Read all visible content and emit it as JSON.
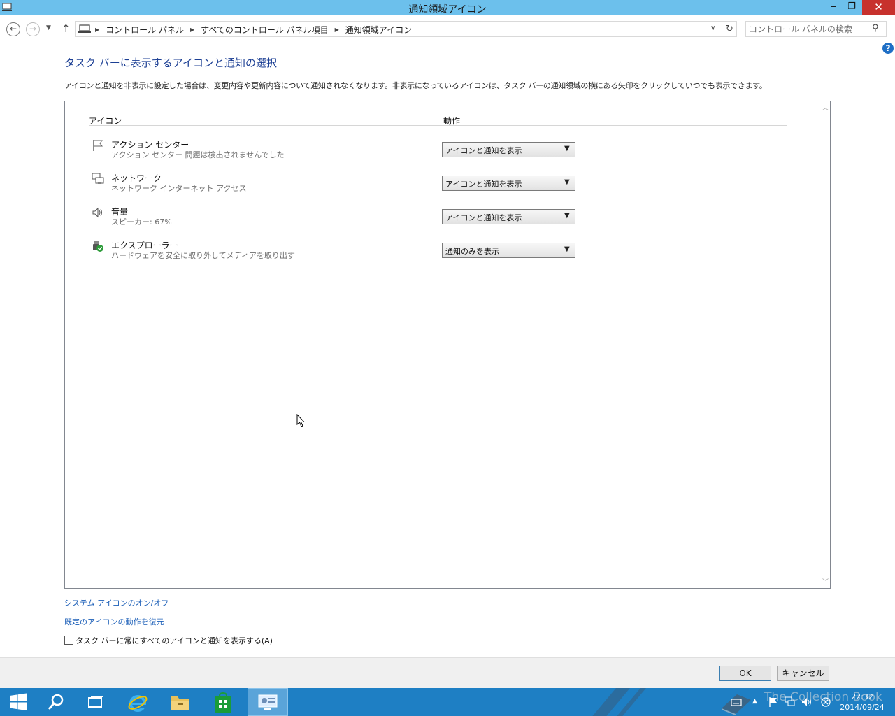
{
  "window": {
    "title": "通知領域アイコン",
    "min_glyph": "‒",
    "max_glyph": "❐",
    "close_glyph": "✕"
  },
  "address": {
    "crumbs": [
      "コントロール パネル",
      "すべてのコントロール パネル項目",
      "通知領域アイコン"
    ],
    "search_placeholder": "コントロール パネルの検索"
  },
  "help_glyph": "?",
  "content": {
    "heading": "タスク バーに表示するアイコンと通知の選択",
    "description": "アイコンと通知を非表示に設定した場合は、変更内容や更新内容について通知されなくなります。非表示になっているアイコンは、タスク バーの通知領域の横にある矢印をクリックしていつでも表示できます。",
    "col_icon": "アイコン",
    "col_action": "動作",
    "rows": [
      {
        "name": "アクション センター",
        "sub": "アクション センター  問題は検出されませんでした",
        "action": "アイコンと通知を表示",
        "icon": "flag-icon"
      },
      {
        "name": "ネットワーク",
        "sub": "ネットワーク インターネット アクセス",
        "action": "アイコンと通知を表示",
        "icon": "network-icon"
      },
      {
        "name": "音量",
        "sub": "スピーカー: 67%",
        "action": "アイコンと通知を表示",
        "icon": "speaker-icon"
      },
      {
        "name": "エクスプローラー",
        "sub": "ハードウェアを安全に取り外してメディアを取り出す",
        "action": "通知のみを表示",
        "icon": "usb-eject-icon"
      }
    ],
    "link_system_icons": "システム アイコンのオン/オフ",
    "link_restore": "既定のアイコンの動作を復元",
    "checkbox_label": "タスク バーに常にすべてのアイコンと通知を表示する(A)"
  },
  "buttons": {
    "ok": "OK",
    "cancel": "キャンセル"
  },
  "taskbar": {
    "time": "22:32",
    "date": "2014/09/24",
    "watermark": "The Collection Book"
  }
}
